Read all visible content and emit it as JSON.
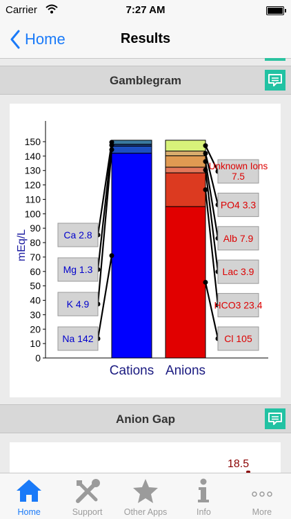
{
  "status_bar": {
    "carrier": "Carrier",
    "time": "7:27 AM"
  },
  "nav": {
    "back_label": "Home",
    "title": "Results"
  },
  "sections": [
    {
      "title": "Gamblegram"
    },
    {
      "title": "Anion Gap"
    }
  ],
  "chart_data": {
    "type": "bar",
    "ylabel": "mEq/L",
    "ylim": [
      0,
      150
    ],
    "ytick_step": 10,
    "categories": [
      "Cations",
      "Anions"
    ],
    "cations": [
      {
        "label": "Na 142",
        "value": 142,
        "color": "#0000ff"
      },
      {
        "label": "K 4.9",
        "value": 4.9,
        "color": "#1d4fc1"
      },
      {
        "label": "Mg 1.3",
        "value": 1.3,
        "color": "#1a3f86"
      },
      {
        "label": "Ca 2.8",
        "value": 2.8,
        "color": "#3a7aa0"
      }
    ],
    "anions": [
      {
        "label": "Cl 105",
        "value": 105,
        "color": "#e10000"
      },
      {
        "label": "HCO3 23.4",
        "value": 23.4,
        "color": "#dc3a20"
      },
      {
        "label": "Lac 3.9",
        "value": 3.9,
        "color": "#e4785a"
      },
      {
        "label": "Alb 7.9",
        "value": 7.9,
        "color": "#e09a52"
      },
      {
        "label": "PO4 3.3",
        "value": 3.3,
        "color": "#d8ac6e"
      },
      {
        "label": "Unknown Ions 7.5",
        "value": 7.5,
        "color": "#d8f27a"
      }
    ]
  },
  "anion_gap_value": "18.5",
  "tabs": [
    {
      "label": "Home",
      "icon": "home-icon",
      "active": true
    },
    {
      "label": "Support",
      "icon": "tools-icon",
      "active": false
    },
    {
      "label": "Other Apps",
      "icon": "star-icon",
      "active": false
    },
    {
      "label": "Info",
      "icon": "info-icon",
      "active": false
    },
    {
      "label": "More",
      "icon": "more-icon",
      "active": false
    }
  ],
  "colors": {
    "accent": "#1a7af8",
    "teal": "#22c2a3",
    "label_blue": "#0000cc",
    "label_red": "#dd0000"
  }
}
